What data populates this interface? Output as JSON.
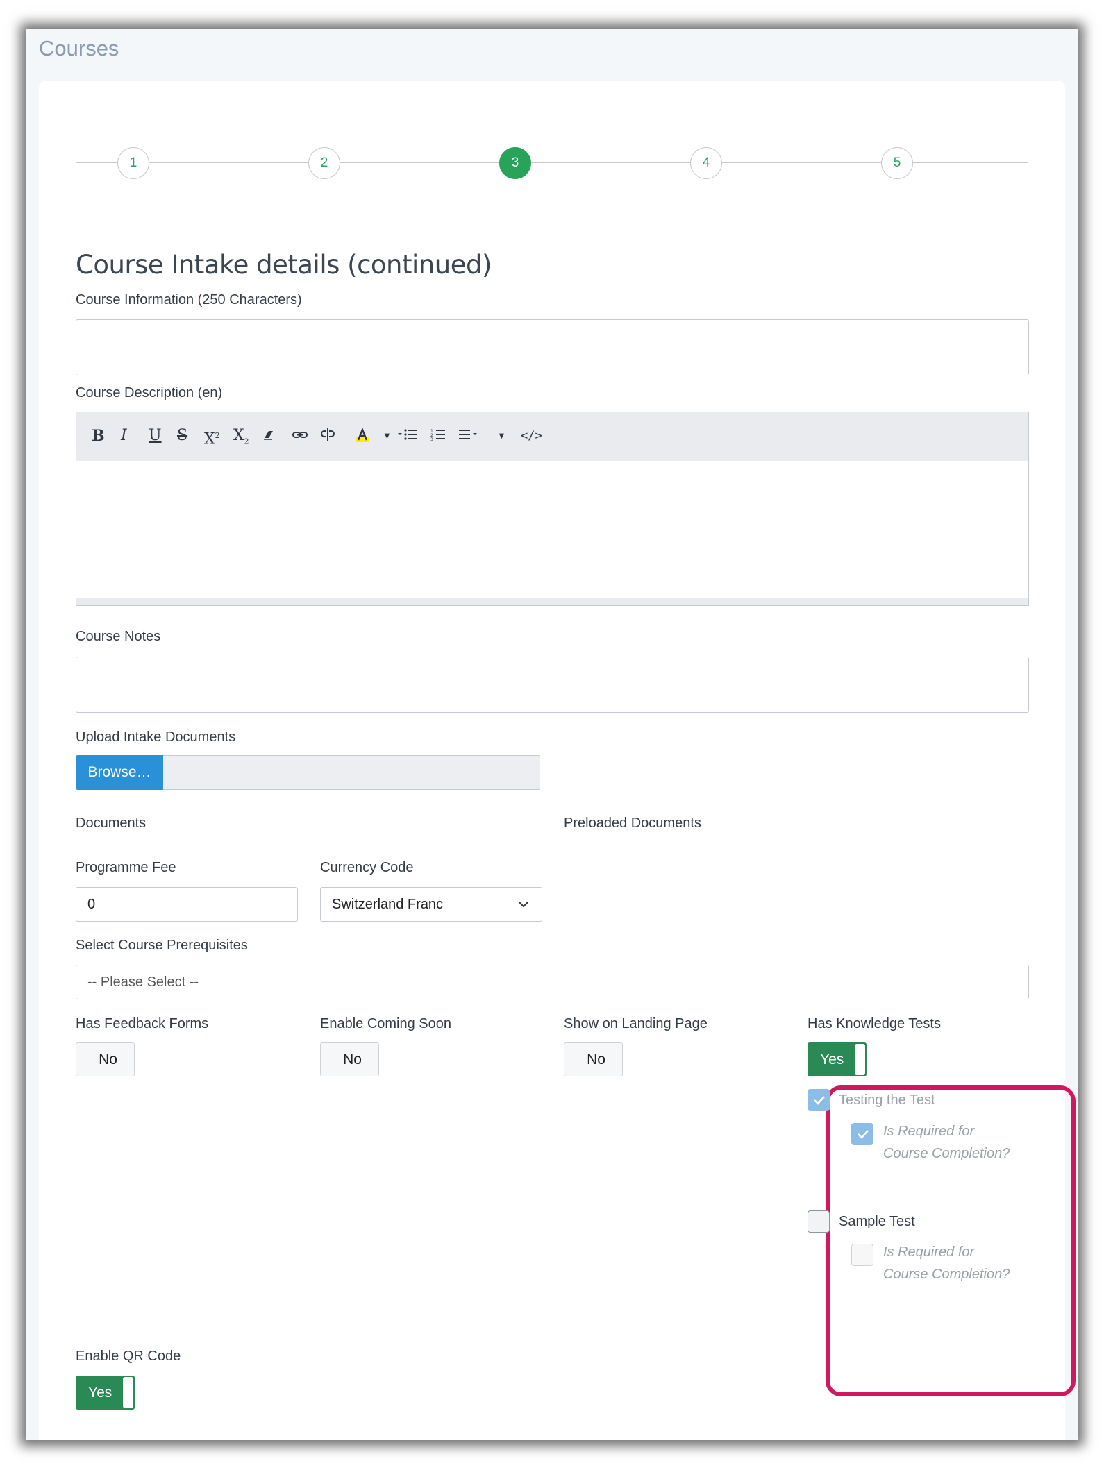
{
  "page": {
    "title": "Courses"
  },
  "stepper": {
    "steps": [
      "1",
      "2",
      "3",
      "4",
      "5"
    ],
    "active": "3"
  },
  "form": {
    "heading": "Course Intake details (continued)",
    "course_information": {
      "label": "Course Information (250 Characters)",
      "value": ""
    },
    "course_description": {
      "label": "Course Description (en)",
      "value": ""
    },
    "editor_toolbar": {
      "bold": "B",
      "italic": "I",
      "underline": "U",
      "strike": "S",
      "superscript": "X",
      "subscript": "X",
      "code": "</>"
    },
    "course_notes": {
      "label": "Course Notes",
      "value": ""
    },
    "upload": {
      "label": "Upload Intake Documents",
      "browse_label": "Browse…"
    },
    "documents": {
      "label": "Documents"
    },
    "preloaded_documents": {
      "label": "Preloaded Documents"
    },
    "programme_fee": {
      "label": "Programme Fee",
      "value": "0"
    },
    "currency_code": {
      "label": "Currency Code",
      "value": "Switzerland Franc"
    },
    "prerequisites": {
      "label": "Select Course Prerequisites",
      "value": "-- Please Select --"
    },
    "has_feedback_forms": {
      "label": "Has Feedback Forms",
      "value": "No"
    },
    "enable_coming_soon": {
      "label": "Enable Coming Soon",
      "value": "No"
    },
    "show_on_landing_page": {
      "label": "Show on Landing Page",
      "value": "No"
    },
    "has_knowledge_tests": {
      "label": "Has Knowledge Tests",
      "value": "Yes",
      "tests": [
        {
          "name": "Testing the Test",
          "checked": true,
          "required_line1": "Is Required for",
          "required_line2": "Course Completion?",
          "required_checked": true
        },
        {
          "name": "Sample Test",
          "checked": false,
          "required_line1": "Is Required for",
          "required_line2": "Course Completion?",
          "required_checked": false
        }
      ]
    },
    "enable_qr_code": {
      "label": "Enable QR Code",
      "value": "Yes"
    }
  },
  "colors": {
    "accent_green": "#28a45a",
    "toggle_green": "#2a8a55",
    "browse_blue": "#2a90d8",
    "highlight": "#d0185f",
    "checkbox_checked": "#8cbde6"
  }
}
